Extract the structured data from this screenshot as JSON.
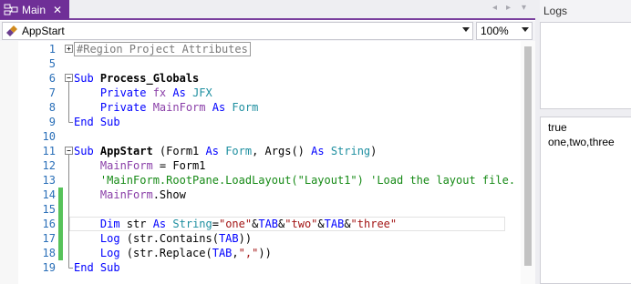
{
  "tab": {
    "label": "Main",
    "close_glyph": "✕",
    "icon": "layout-icon"
  },
  "tab_nav": {
    "prev": "◂",
    "next": "▸",
    "menu": "▾"
  },
  "module_combo": {
    "value": "AppStart",
    "icon": "method-icon"
  },
  "zoom_combo": {
    "value": "100%"
  },
  "editor": {
    "line_numbers": [
      "1",
      "5",
      "6",
      "7",
      "8",
      "9",
      "10",
      "11",
      "12",
      "13",
      "14",
      "15",
      "16",
      "17",
      "18",
      "19"
    ],
    "changed_lines": [
      "14",
      "15",
      "16",
      "17",
      "18"
    ],
    "current_line": "16",
    "lines": [
      {
        "fold": "plus",
        "tokens": [
          {
            "t": "#Region Project Attributes",
            "c": "region-box"
          }
        ]
      },
      {
        "fold": "",
        "tokens": []
      },
      {
        "fold": "minus",
        "tokens": [
          {
            "t": "Sub ",
            "c": "kw"
          },
          {
            "t": "Process_Globals",
            "c": "sb"
          }
        ]
      },
      {
        "fold": "bar",
        "tokens": [
          {
            "t": "    Private ",
            "c": "kw"
          },
          {
            "t": "fx",
            "c": "var"
          },
          {
            "t": " As ",
            "c": "kw"
          },
          {
            "t": "JFX",
            "c": "ty"
          }
        ]
      },
      {
        "fold": "bar",
        "tokens": [
          {
            "t": "    Private ",
            "c": "kw"
          },
          {
            "t": "MainForm",
            "c": "var"
          },
          {
            "t": " As ",
            "c": "kw"
          },
          {
            "t": "Form",
            "c": "ty"
          }
        ]
      },
      {
        "fold": "end",
        "tokens": [
          {
            "t": "End Sub",
            "c": "kw"
          }
        ]
      },
      {
        "fold": "",
        "tokens": []
      },
      {
        "fold": "minus",
        "tokens": [
          {
            "t": "Sub ",
            "c": "kw"
          },
          {
            "t": "AppStart",
            "c": "sb"
          },
          {
            "t": " (Form1 ",
            "c": ""
          },
          {
            "t": "As ",
            "c": "kw"
          },
          {
            "t": "Form",
            "c": "ty"
          },
          {
            "t": ", Args() ",
            "c": ""
          },
          {
            "t": "As ",
            "c": "kw"
          },
          {
            "t": "String",
            "c": "ty"
          },
          {
            "t": ")",
            "c": ""
          }
        ]
      },
      {
        "fold": "bar",
        "tokens": [
          {
            "t": "    ",
            "c": ""
          },
          {
            "t": "MainForm",
            "c": "var"
          },
          {
            "t": " = Form1",
            "c": ""
          }
        ]
      },
      {
        "fold": "bar",
        "tokens": [
          {
            "t": "    'MainForm.RootPane.LoadLayout(\"Layout1\") 'Load the layout file.",
            "c": "cm"
          }
        ]
      },
      {
        "fold": "bar",
        "tokens": [
          {
            "t": "    ",
            "c": ""
          },
          {
            "t": "MainForm",
            "c": "var"
          },
          {
            "t": ".Show",
            "c": ""
          }
        ]
      },
      {
        "fold": "bar",
        "tokens": []
      },
      {
        "fold": "bar",
        "tokens": [
          {
            "t": "    Dim ",
            "c": "kw"
          },
          {
            "t": "str",
            "c": ""
          },
          {
            "t": " As ",
            "c": "kw"
          },
          {
            "t": "String",
            "c": "ty"
          },
          {
            "t": "=",
            "c": ""
          },
          {
            "t": "\"one\"",
            "c": "str"
          },
          {
            "t": "&",
            "c": ""
          },
          {
            "t": "TAB",
            "c": "kw"
          },
          {
            "t": "&",
            "c": ""
          },
          {
            "t": "\"two\"",
            "c": "str"
          },
          {
            "t": "&",
            "c": ""
          },
          {
            "t": "TAB",
            "c": "kw"
          },
          {
            "t": "&",
            "c": ""
          },
          {
            "t": "\"three\"",
            "c": "str"
          }
        ]
      },
      {
        "fold": "bar",
        "tokens": [
          {
            "t": "    Log",
            "c": "kw"
          },
          {
            "t": " (str.Contains(",
            "c": ""
          },
          {
            "t": "TAB",
            "c": "kw"
          },
          {
            "t": "))",
            "c": ""
          }
        ]
      },
      {
        "fold": "bar",
        "tokens": [
          {
            "t": "    Log",
            "c": "kw"
          },
          {
            "t": " (str.Replace(",
            "c": ""
          },
          {
            "t": "TAB",
            "c": "kw"
          },
          {
            "t": ",",
            "c": ""
          },
          {
            "t": "\",\"",
            "c": "str"
          },
          {
            "t": "))",
            "c": ""
          }
        ]
      },
      {
        "fold": "end",
        "tokens": [
          {
            "t": "End Sub",
            "c": "kw"
          }
        ]
      }
    ]
  },
  "logs": {
    "title": "Logs",
    "entries": [
      "true",
      "one,two,three"
    ]
  },
  "colors": {
    "tab_accent": "#6f2f97",
    "change_marker": "#57c25a",
    "line_number": "#2a6fb8"
  }
}
